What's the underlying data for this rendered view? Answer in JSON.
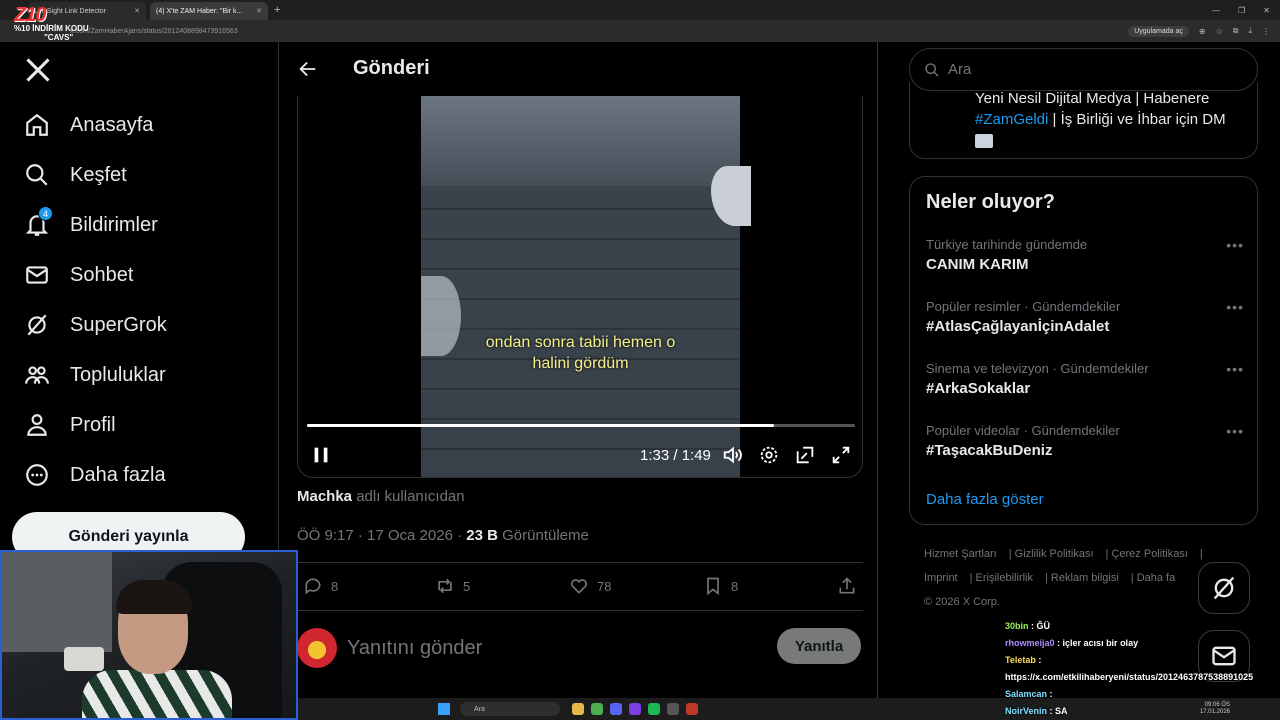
{
  "browser": {
    "tabs": [
      {
        "label": "LinkSight Link Detector"
      },
      {
        "label": "(4) X'te ZAM Haber: \"Bir k..."
      }
    ],
    "url": "x.com/ZamHaberAjans/status/2012408898473916563",
    "open_in_app": "Uygulamada aç"
  },
  "promo": {
    "logo": "Z10",
    "code": "%10 İNDİRİM KODU",
    "name": "\"CAVS\""
  },
  "nav": {
    "items": [
      {
        "label": "Anasayfa",
        "icon": "home-icon"
      },
      {
        "label": "Keşfet",
        "icon": "search-icon"
      },
      {
        "label": "Bildirimler",
        "icon": "bell-icon",
        "badge": "4"
      },
      {
        "label": "Sohbet",
        "icon": "mail-icon"
      },
      {
        "label": "SuperGrok",
        "icon": "grok-icon"
      },
      {
        "label": "Topluluklar",
        "icon": "people-icon"
      },
      {
        "label": "Profil",
        "icon": "person-icon"
      },
      {
        "label": "Daha fazla",
        "icon": "more-circle-icon"
      }
    ],
    "post_button": "Gönderi yayınla"
  },
  "main": {
    "title": "Gönderi",
    "video": {
      "subtitle_line1": "ondan sonra tabii hemen o",
      "subtitle_line2": "halini gördüm",
      "time": "1:33 / 1:49",
      "progress": 0.853
    },
    "from": {
      "user": "Machka",
      "suffix": "adlı kullanıcıdan"
    },
    "meta": {
      "datetime": "ÖÖ 9:17 · 17 Oca 2026 · ",
      "views": "23 B",
      "views_label": "Görüntüleme"
    },
    "actions": {
      "replies": "8",
      "reposts": "5",
      "likes": "78",
      "bookmarks": "8"
    },
    "reply": {
      "placeholder": "Yanıtını gönder",
      "button": "Yanıtla"
    }
  },
  "right": {
    "search_placeholder": "Ara",
    "bio": {
      "line1": "Yeni Nesil Dijital Medya | Habenere",
      "hashtag": "#ZamGeldi",
      "line2_rest": " | İş Birliği ve İhbar için DM"
    },
    "trends_title": "Neler oluyor?",
    "trends": [
      {
        "category": "Türkiye tarihinde gündemde",
        "name": "CANIM KARIM"
      },
      {
        "category": "Popüler resimler · Gündemdekiler",
        "name": "#AtlasÇağlayanİçinAdalet"
      },
      {
        "category": "Sinema ve televizyon · Gündemdekiler",
        "name": "#ArkaSokaklar"
      },
      {
        "category": "Popüler videolar · Gündemdekiler",
        "name": "#TaşacakBuDeniz"
      }
    ],
    "show_more": "Daha fazla göster",
    "footer": [
      "Hizmet Şartları",
      "Gizlilik Politikası",
      "Çerez Politikası",
      "Imprint",
      "Erişilebilirlik",
      "Reklam bilgisi",
      "Daha fa"
    ],
    "copyright": "© 2026 X Corp."
  },
  "chat": [
    {
      "user": "30bin",
      "msg": "ĞÜ"
    },
    {
      "user": "rhowmeija0",
      "msg": "içler acısı bir olay"
    },
    {
      "user": "Teletab",
      "msg": ""
    },
    {
      "user": "",
      "msg": "https://x.com/etkilihaberyeni/status/2012463787538891025"
    },
    {
      "user": "Salamcan",
      "msg": ""
    },
    {
      "user": "NoirVenin",
      "msg": "SA"
    }
  ],
  "taskbar": {
    "search": "Ara",
    "time": "09:06 ÖS",
    "date": "17.01.2026"
  }
}
